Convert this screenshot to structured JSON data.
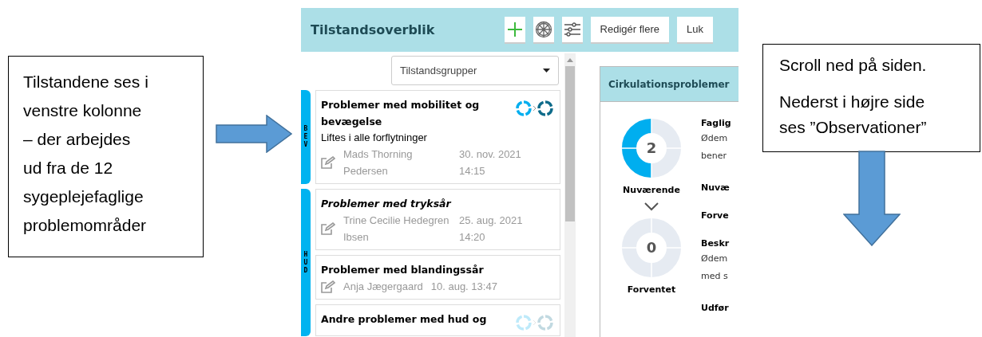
{
  "left_note": {
    "text": "Tilstandene ses i\nvenstre kolonne\n– der arbejdes\nud fra de 12\nsygeplejefaglige\nproblemområder"
  },
  "app": {
    "title": "Tilstandsoverblik",
    "toolbar": [
      {
        "kind": "add"
      },
      {
        "kind": "wheel"
      },
      {
        "kind": "sliders"
      },
      {
        "kind": "text",
        "label": "Redigér flere"
      },
      {
        "kind": "text",
        "label": "Luk"
      }
    ],
    "dropdown": {
      "value": "Tilstandsgrupper"
    },
    "groups": [
      {
        "label": "BEV",
        "cards": [
          {
            "title": "Problemer med mobilitet og bevægelse",
            "italic": false,
            "subtitle": "Liftes i alle forflytninger",
            "author": "Mads Thorning Pedersen",
            "time": "30. nov. 2021 14:15",
            "rings": {
              "faded": false
            }
          }
        ]
      },
      {
        "label": "HUD",
        "cards": [
          {
            "title": "Problemer med tryksår",
            "italic": true,
            "author": "Trine Cecilie Hedegren Ibsen",
            "time": "25. aug. 2021 14:20"
          },
          {
            "title": "Problemer med blandingssår",
            "italic": false,
            "author": "Anja Jægergaard",
            "time": "10. aug. 13:47"
          },
          {
            "title": "Andre problemer med hud og",
            "italic": false,
            "rings": {
              "faded": true
            }
          }
        ]
      }
    ],
    "detail": {
      "title": "Cirkulationsproblemer",
      "gauges": [
        {
          "value": "2",
          "level": 0.5,
          "label": "Nuværende"
        },
        {
          "value": "0",
          "level": 0,
          "label": "Forventet"
        }
      ],
      "fields": [
        {
          "heading": "Faglig",
          "text": "Ødem\nbener"
        },
        {
          "heading": "Nuvæ"
        },
        {
          "heading": "Forve"
        },
        {
          "heading": "Beskr",
          "text": "Ødem\nmed s"
        },
        {
          "heading": "Udfør"
        }
      ]
    }
  },
  "right_note": {
    "paragraphs": [
      "Scroll ned på siden.",
      "Nederst i højre side ses ”Observationer”"
    ]
  }
}
